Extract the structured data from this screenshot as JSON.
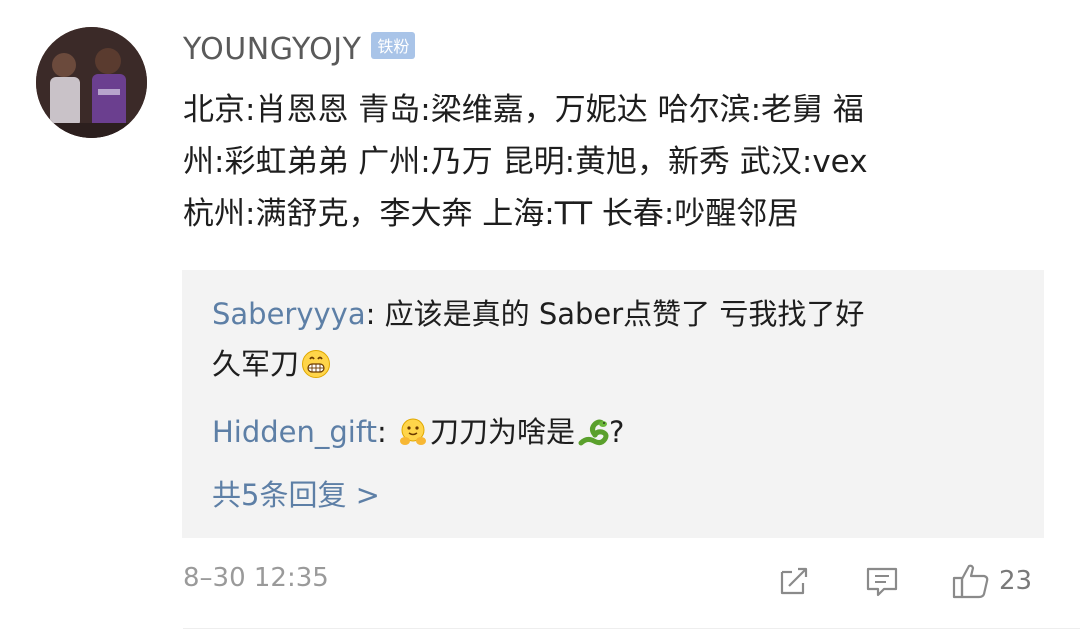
{
  "comment": {
    "username": "YOUNGYOJY",
    "badge": "铁粉",
    "lines": [
      "北京:肖恩恩 青岛:梁维嘉，万妮达 哈尔滨:老舅 福",
      "州:彩虹弟弟 广州:乃万 昆明:黄旭，新秀 武汉:vex",
      "杭州:满舒克，李大奔 上海:TT 长春:吵醒邻居"
    ],
    "timestamp": "8–30 12:35",
    "like_count": "23"
  },
  "replies": [
    {
      "author": "Saberyyya",
      "separator": ": ",
      "line1": "应该是真的 Saber点赞了 亏我找了好",
      "line2": "久军刀",
      "emoji": "grinning-face"
    },
    {
      "author": "Hidden_gift",
      "separator": ": ",
      "text_before": "刀刀为啥是",
      "text_after": "?",
      "emoji_pre": "hugging-face",
      "emoji_mid": "snake"
    }
  ],
  "more_replies": "共5条回复 >",
  "colors": {
    "link_blue": "#5d7fa6",
    "badge_bg": "#a9c4e8",
    "reply_bg": "#f3f3f3",
    "muted": "#9a9a9a"
  },
  "icons": [
    "share-icon",
    "comment-icon",
    "thumbs-up-icon"
  ]
}
